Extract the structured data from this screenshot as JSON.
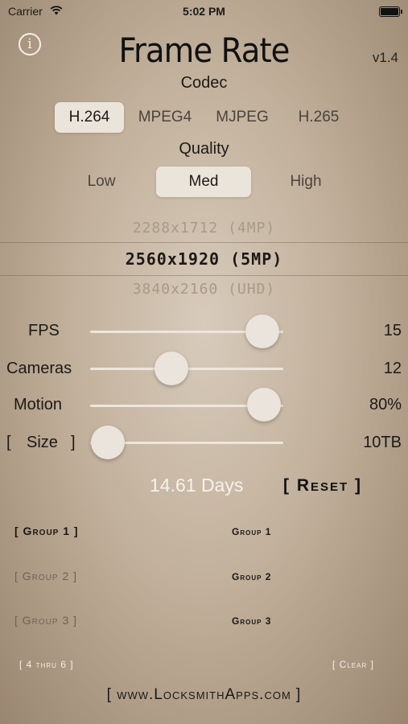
{
  "status_bar": {
    "carrier": "Carrier",
    "time": "5:02 PM"
  },
  "header": {
    "info_icon_glyph": "i",
    "title": "Frame Rate",
    "version": "v1.4"
  },
  "codec": {
    "label": "Codec",
    "options": [
      "H.264",
      "MPEG4",
      "MJPEG",
      "H.265"
    ],
    "selected": "H.264"
  },
  "quality": {
    "label": "Quality",
    "options": [
      "Low",
      "Med",
      "High"
    ],
    "selected": "Med"
  },
  "resolution_picker": {
    "above": "2288x1712 (4MP)",
    "selected": "2560x1920 (5MP)",
    "below": "3840x2160 (UHD)"
  },
  "sliders": {
    "fps": {
      "label": "FPS",
      "value": "15",
      "fraction": 0.79
    },
    "cameras": {
      "label": "Cameras",
      "value": "12",
      "fraction": 0.36
    },
    "motion": {
      "label": "Motion",
      "value": "80%",
      "fraction": 0.8
    },
    "size": {
      "label_open": "[",
      "label": "Size",
      "label_close": "]",
      "value": "10TB",
      "fraction": 0.06
    }
  },
  "result": {
    "days": "14.61 Days",
    "reset_label": "[ Reset ]"
  },
  "groups": [
    {
      "button": "[ Group 1 ]",
      "name": "Group 1",
      "active": true
    },
    {
      "button": "[ Group 2 ]",
      "name": "Group 2",
      "active": false
    },
    {
      "button": "[ Group 3 ]",
      "name": "Group 3",
      "active": false
    }
  ],
  "footer": {
    "range_button": "[ 4 thru 6 ]",
    "clear_button": "[ Clear ]",
    "website": "[ www.LocksmithApps.com ]"
  },
  "colors": {
    "selected_segment": "#ebe4da",
    "days_text": "#f6f2ec",
    "slider_track": "#ede6dd"
  }
}
